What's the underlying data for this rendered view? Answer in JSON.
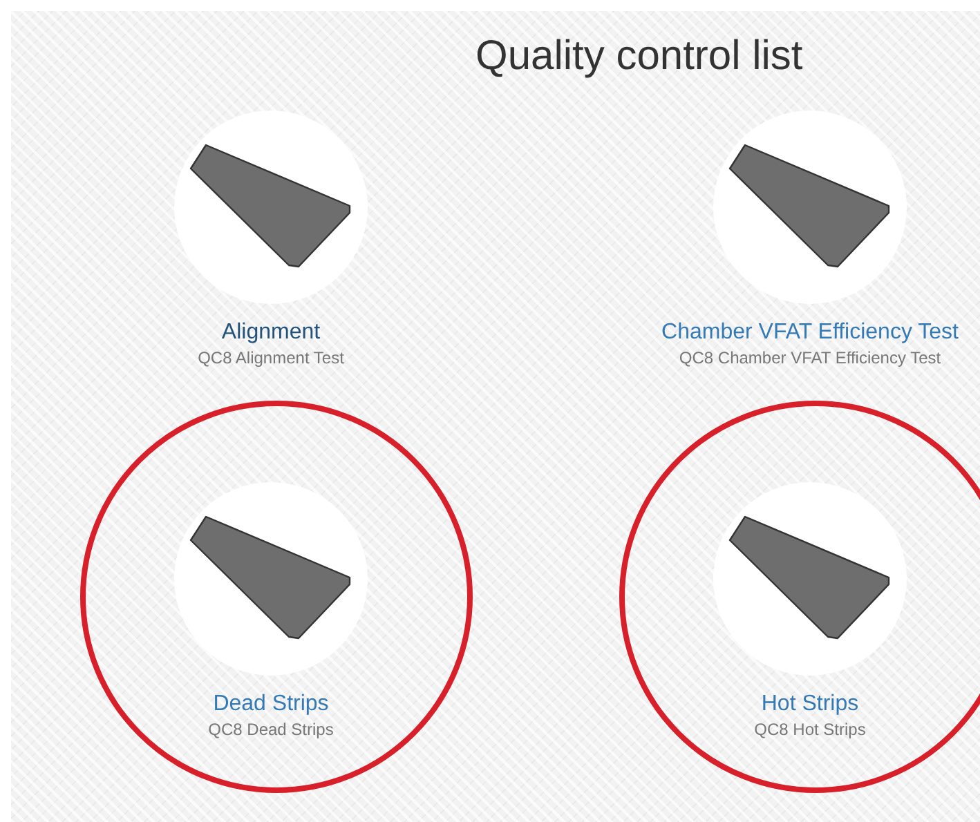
{
  "title": "Quality control list",
  "items": [
    {
      "name": "Alignment",
      "description": "QC8 Alignment Test",
      "hovered": true,
      "circled": false
    },
    {
      "name": "Chamber VFAT Efficiency Test",
      "description": "QC8 Chamber VFAT Efficiency Test",
      "hovered": false,
      "circled": false
    },
    {
      "name": "Dead Strips",
      "description": "QC8 Dead Strips",
      "hovered": false,
      "circled": true
    },
    {
      "name": "Hot Strips",
      "description": "QC8 Hot Strips",
      "hovered": false,
      "circled": true
    }
  ]
}
